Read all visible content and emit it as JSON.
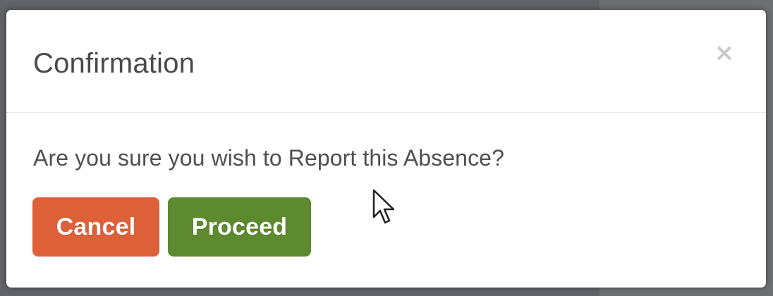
{
  "dialog": {
    "title": "Confirmation",
    "close_symbol": "×",
    "message": "Are you sure you wish to Report this Absence?",
    "buttons": {
      "cancel_label": "Cancel",
      "proceed_label": "Proceed"
    }
  },
  "colors": {
    "cancel_button": "#dd6039",
    "proceed_button": "#5d8a2e",
    "title_text": "#4a4a4a",
    "body_text": "#4f4f4f",
    "close_icon": "#c9c9c9"
  },
  "icons": {
    "close": "close-icon",
    "cursor": "mouse-pointer-icon"
  }
}
